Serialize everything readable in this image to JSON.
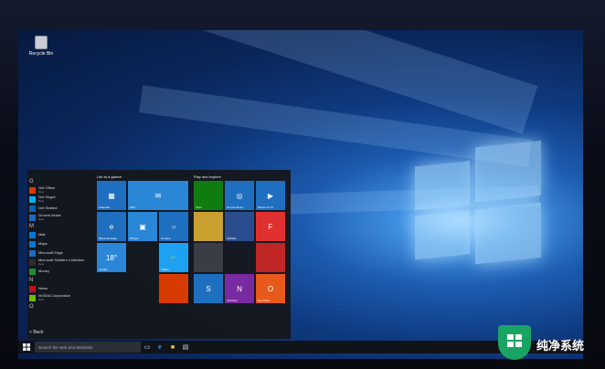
{
  "desktop": {
    "recycle_bin_label": "Recycle Bin"
  },
  "start_menu": {
    "apps": [
      {
        "letter": "G"
      },
      {
        "name": "Get Office",
        "sub": "New",
        "color": "#d83b01"
      },
      {
        "name": "Get Skype",
        "sub": "New",
        "color": "#00aff0"
      },
      {
        "name": "Get Started",
        "sub": "",
        "color": "#0063b1"
      },
      {
        "name": "Groove Music",
        "sub": "New",
        "color": "#1e6ac8"
      },
      {
        "letter": "M"
      },
      {
        "name": "Mail",
        "sub": "",
        "color": "#0078d7"
      },
      {
        "name": "Maps",
        "sub": "",
        "color": "#0078d7"
      },
      {
        "name": "Microsoft Edge",
        "sub": "",
        "color": "#1e6ac8"
      },
      {
        "name": "Microsoft Solitaire Collection",
        "sub": "New",
        "color": "#2d2d30"
      },
      {
        "name": "Money",
        "sub": "",
        "color": "#1e8c3a"
      },
      {
        "letter": "N"
      },
      {
        "name": "News",
        "sub": "",
        "color": "#c50f1f"
      },
      {
        "name": "NVIDIA Corporation",
        "sub": "New",
        "color": "#76b900"
      },
      {
        "letter": "O"
      }
    ],
    "back_label": "Back",
    "group1_label": "Life at a glance",
    "group2_label": "Play and explore",
    "tiles": [
      {
        "label": "Calendar",
        "icon": "▦",
        "color": "#1f6fc0"
      },
      {
        "label": "Mail",
        "icon": "✉",
        "color": "#2a86d6"
      },
      {
        "label": "Microsoft Edge",
        "icon": "e",
        "color": "#1f6fc0"
      },
      {
        "label": "Photos",
        "icon": "▣",
        "color": "#2a86d6"
      },
      {
        "label": "Cortana",
        "icon": "○",
        "color": "#1f6fc0"
      },
      {
        "label": "London",
        "icon": "18°",
        "color": "#2a86d6"
      },
      {
        "label": "Twitter",
        "icon": "🐦",
        "color": "#1da1f2"
      },
      {
        "label": "Xbox",
        "icon": "",
        "color": "#107c10"
      },
      {
        "label": "Groove Music",
        "icon": "◎",
        "color": "#1f6fc0"
      },
      {
        "label": "Movies & TV",
        "icon": "▶",
        "color": "#1f6fc0"
      },
      {
        "label": "",
        "icon": "",
        "color": "#c8a030"
      },
      {
        "label": "Solitaire",
        "icon": "",
        "color": "#2a4d8f"
      },
      {
        "label": "",
        "icon": "F",
        "color": "#e03030"
      },
      {
        "label": "",
        "icon": "",
        "color": "#3a3d44"
      },
      {
        "label": "",
        "icon": "",
        "color": "#c02626"
      },
      {
        "label": "OneNote",
        "icon": "N",
        "color": "#7a2aa0"
      },
      {
        "label": "Get Office",
        "icon": "O",
        "color": "#e85a1b"
      },
      {
        "label": "",
        "icon": "",
        "color": "#d83b01"
      },
      {
        "label": "",
        "icon": "S",
        "color": "#1f6fc0"
      }
    ]
  },
  "taskbar": {
    "search_placeholder": "Search the web and Windows",
    "icons": [
      "start-icon",
      "task-view-icon",
      "edge-icon",
      "file-explorer-icon",
      "store-icon"
    ]
  },
  "watermark": {
    "text": "纯净系统"
  }
}
